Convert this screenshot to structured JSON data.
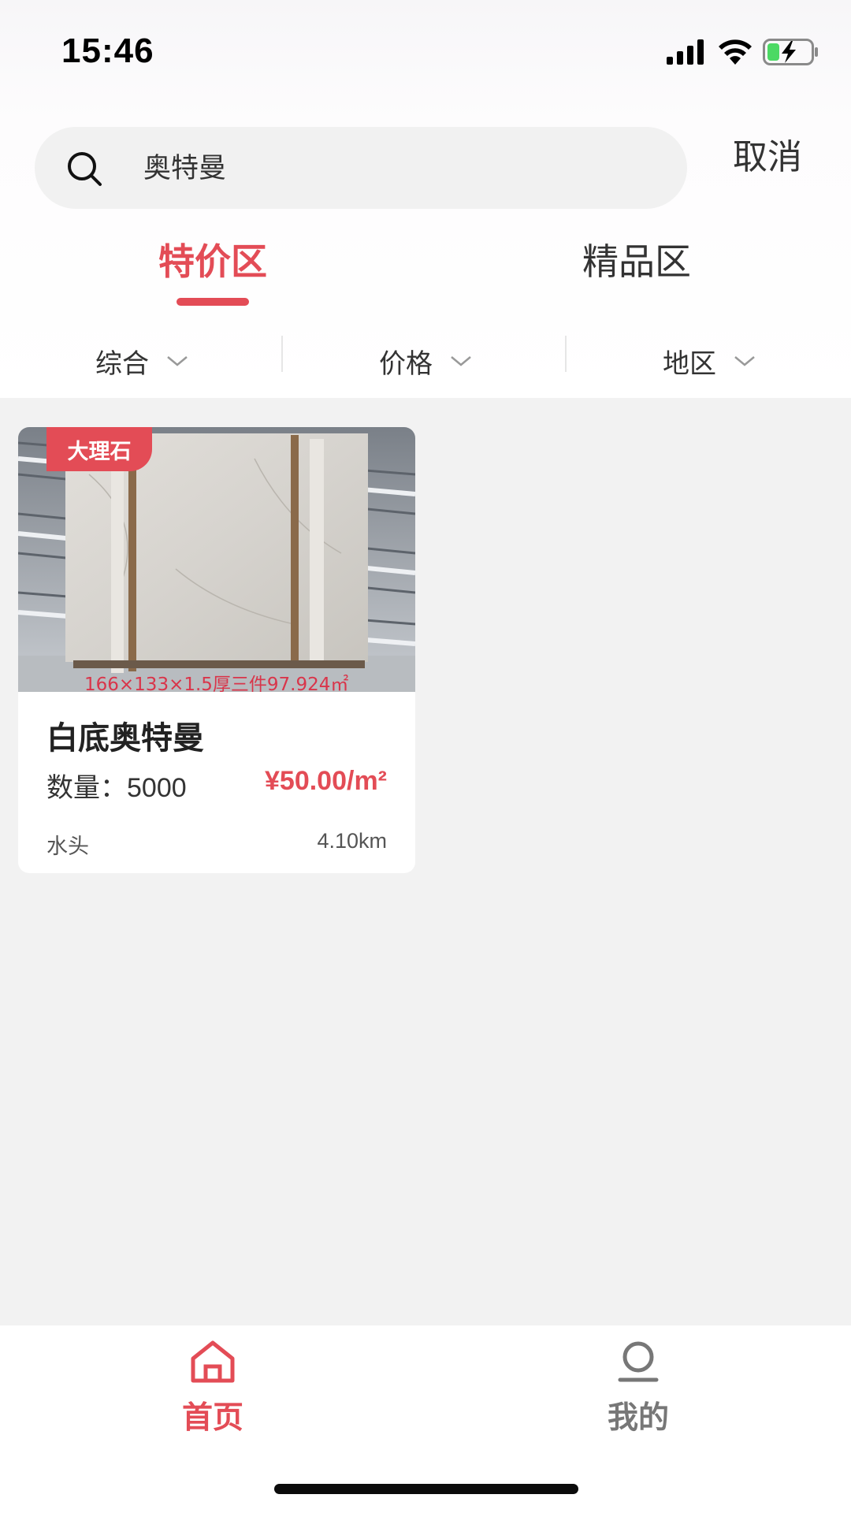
{
  "status_bar": {
    "time": "15:46",
    "icons": [
      "signal-icon",
      "wifi-icon",
      "battery-charging-icon"
    ]
  },
  "search": {
    "query": "奥特曼",
    "icon": "search-icon",
    "cancel_label": "取消"
  },
  "tabs": [
    {
      "label": "特价区",
      "active": true
    },
    {
      "label": "精品区",
      "active": false
    }
  ],
  "filters": [
    {
      "label": "综合",
      "icon": "chevron-down-icon"
    },
    {
      "label": "价格",
      "icon": "chevron-down-icon"
    },
    {
      "label": "地区",
      "icon": "chevron-down-icon"
    }
  ],
  "products": [
    {
      "badge": "大理石",
      "image_caption": "166×133×1.5厚三件97.924㎡",
      "name": "白底奥特曼",
      "quantity_label": "数量：",
      "quantity": "5000",
      "price": "¥50.00/m²",
      "location": "水头",
      "distance": "4.10km"
    }
  ],
  "bottom_nav": [
    {
      "label": "首页",
      "icon": "home-icon",
      "active": true
    },
    {
      "label": "我的",
      "icon": "user-icon",
      "active": false
    }
  ],
  "colors": {
    "accent": "#e34c56",
    "background": "#f2f2f2"
  }
}
